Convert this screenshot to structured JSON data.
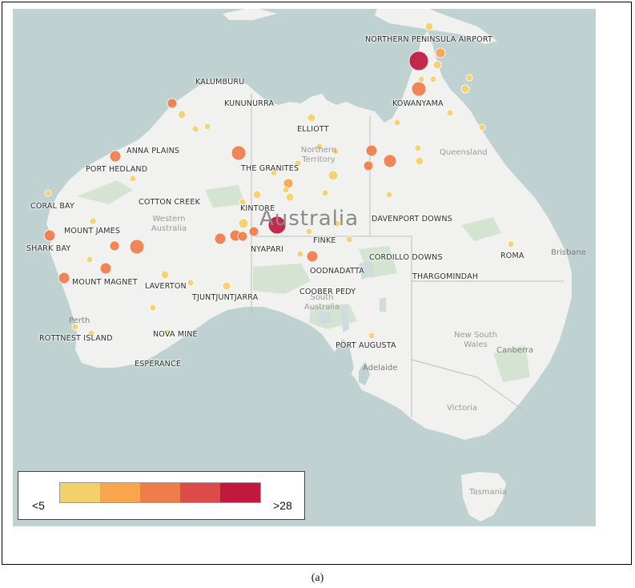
{
  "map": {
    "country_label": "Australia",
    "state_labels": [
      "Western Australia",
      "Northern Territory",
      "Queensland",
      "South Australia",
      "New South Wales",
      "Victoria",
      "Tasmania"
    ],
    "city_labels": [
      "Perth",
      "Adelaide",
      "Brisbane",
      "Canberra"
    ],
    "places": [
      "NORTHERN PENINSULA AIRPORT",
      "KOWANYAMA",
      "KALUMBURU",
      "KUNUNURRA",
      "ELLIOTT",
      "ANNA PLAINS",
      "PORT HEDLAND",
      "THE GRANITES",
      "CORAL BAY",
      "COTTON CREEK",
      "KINTORE",
      "DAVENPORT DOWNS",
      "MOUNT JAMES",
      "SHARK BAY",
      "NYAPARI",
      "FINKE",
      "CORDILLO DOWNS",
      "ROMA",
      "OODNADATTA",
      "THARGOMINDAH",
      "MOUNT MAGNET",
      "LAVERTON",
      "TJUNTJUNTJARRA",
      "COOBER PEDY",
      "ROTTNEST ISLAND",
      "NOVA MINE",
      "PORT AUGUSTA",
      "ESPERANCE"
    ],
    "colors": {
      "ocean": "#bfd2d1",
      "land": "#f1f1f0",
      "park": "#d5e4d2",
      "lake": "#cfdcdc",
      "border": "#bdbdbd"
    }
  },
  "legend": {
    "min_label": "<5",
    "max_label": ">28",
    "colors": [
      "#f4d06b",
      "#f9a54e",
      "#f07c4a",
      "#dc4b48",
      "#c0193d"
    ]
  },
  "caption": "(a)"
}
